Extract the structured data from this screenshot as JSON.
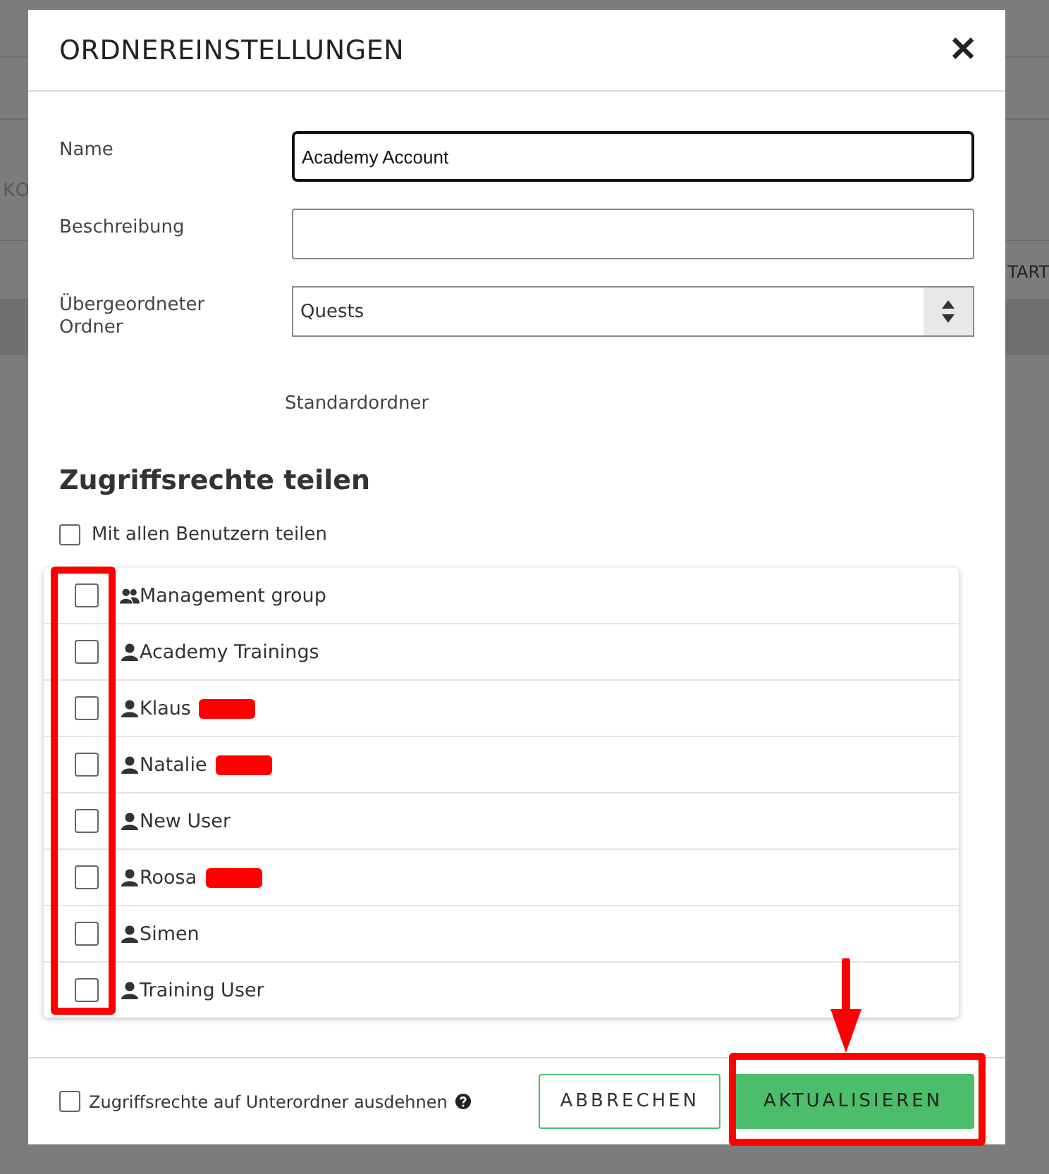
{
  "background": {
    "left_text": "KO",
    "right_text": "TART"
  },
  "dialog": {
    "title": "ORDNEREINSTELLUNGEN",
    "close": "✕"
  },
  "form": {
    "name": {
      "label": "Name",
      "value": "Academy Account",
      "focused": true
    },
    "description": {
      "label": "Beschreibung"
    },
    "parent": {
      "label": "Übergeordneter Ordner",
      "value": "Quests"
    },
    "default_folder": "Standardordner"
  },
  "sharing": {
    "heading": "Zugriffsrechte teilen",
    "share_all": {
      "label": "Mit allen Benutzern teilen",
      "checked": false
    },
    "users": [
      {
        "name": "Management group",
        "kind": "group",
        "checked": false,
        "redacted": false
      },
      {
        "name": "Academy Trainings",
        "kind": "user",
        "checked": false,
        "redacted": false
      },
      {
        "name": "Klaus",
        "kind": "user",
        "checked": false,
        "redacted": true
      },
      {
        "name": "Natalie",
        "kind": "user",
        "checked": false,
        "redacted": true
      },
      {
        "name": "New User",
        "kind": "user",
        "checked": false,
        "redacted": false
      },
      {
        "name": "Roosa",
        "kind": "user",
        "checked": false,
        "redacted": true
      },
      {
        "name": "Simen",
        "kind": "user",
        "checked": false,
        "redacted": false
      },
      {
        "name": "Training User",
        "kind": "user",
        "checked": false,
        "redacted": false
      }
    ]
  },
  "footer": {
    "extend": {
      "label": "Zugriffsrechte auf Unterordner ausdehnen",
      "checked": false
    },
    "cancel": "ABBRECHEN",
    "submit": "AKTUALISIEREN"
  }
}
